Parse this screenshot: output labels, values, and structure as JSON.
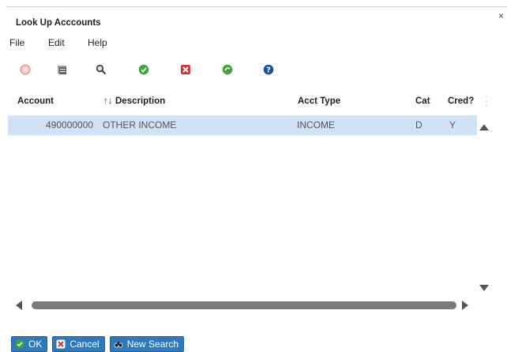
{
  "dialog": {
    "title": "Look Up Acccounts",
    "close_glyph": "×"
  },
  "menu": {
    "file": "File",
    "edit": "Edit",
    "help": "Help"
  },
  "toolbar": {
    "icons": [
      "settings-icon",
      "grid-icon",
      "search-icon",
      "check-icon",
      "cancel-icon",
      "refresh-icon",
      "help-icon"
    ]
  },
  "grid": {
    "columns": {
      "account": "Account",
      "sort_glyph": "↑↓",
      "description": "Description",
      "acct_type": "Acct Type",
      "cat": "Cat",
      "cred": "Cred?"
    },
    "rows": [
      {
        "account": "490000000",
        "description": "OTHER INCOME",
        "acct_type": "INCOME",
        "cat": "D",
        "cred": "Y"
      }
    ],
    "selected_row_color": "#cfe2f6"
  },
  "footer": {
    "ok": "OK",
    "cancel": "Cancel",
    "new_search": "New Search"
  },
  "colors": {
    "button_blue": "#2e79be",
    "ok_green": "#3fa53f",
    "cancel_red": "#d9332b"
  }
}
